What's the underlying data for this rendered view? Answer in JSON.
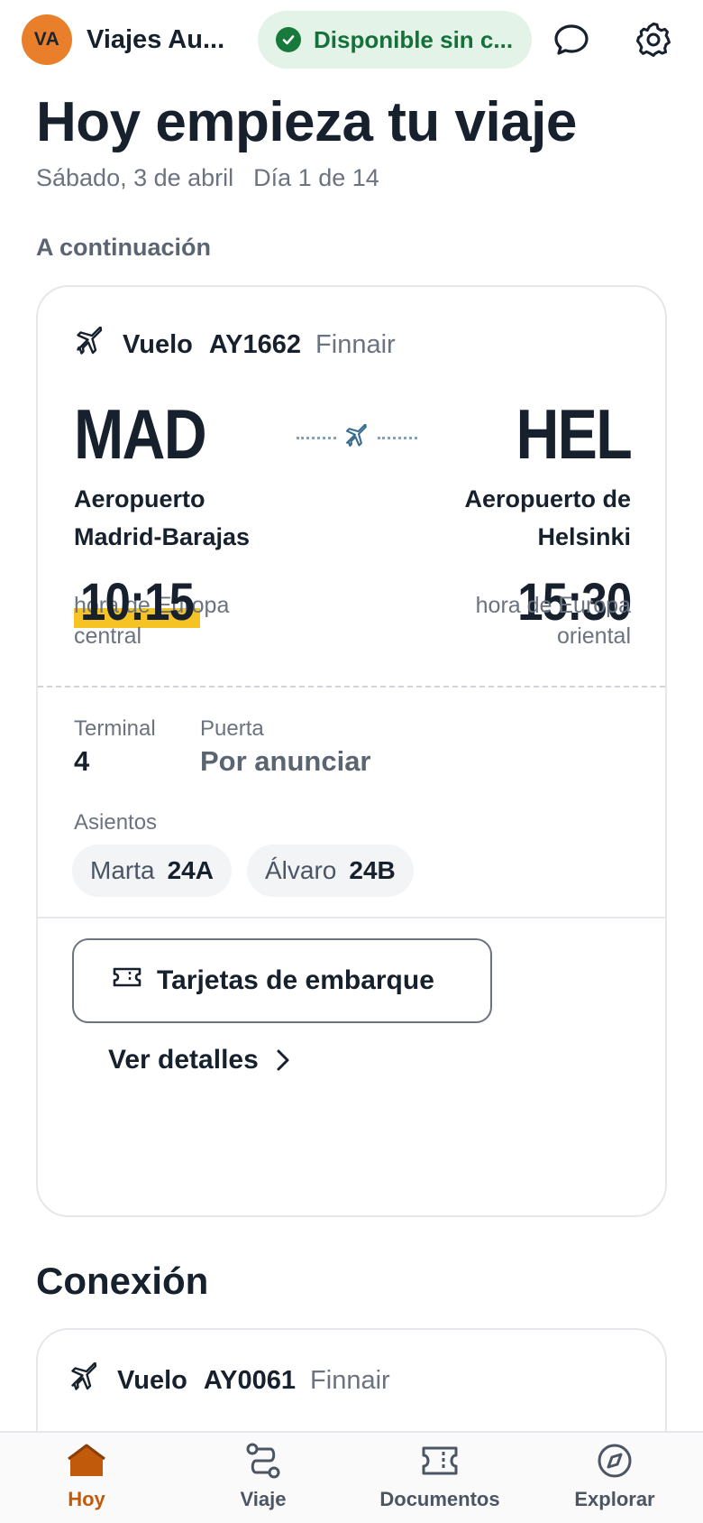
{
  "header": {
    "avatar_initials": "VA",
    "agency_name": "Viajes Au...",
    "status_text": "Disponible sin c...",
    "status_color": "#15703a",
    "chat_icon": "chat-bubble-icon",
    "settings_icon": "gear-icon"
  },
  "page": {
    "title": "Hoy empieza tu viaje",
    "date": "Sábado, 3 de abril",
    "day_of_trip": "Día 1 de 14",
    "next_label": "A continuación"
  },
  "flight": {
    "label": "Vuelo",
    "number": "AY1662",
    "airline": "Finnair",
    "from_code": "MAD",
    "to_code": "HEL",
    "from_airport_line1": "Aeropuerto",
    "from_airport_line2": "Madrid-Barajas",
    "to_airport_line1": "Aeropuerto de",
    "to_airport_line2": "Helsinki",
    "departure_time": "10:15",
    "arrival_time": "15:30",
    "from_tz_line1": "hora de Europa",
    "from_tz_line2": "central",
    "to_tz_line1": "hora de Europa",
    "to_tz_line2": "oriental",
    "terminal_label": "Terminal",
    "terminal_value": "4",
    "gate_label": "Puerta",
    "gate_value": "Por anunciar",
    "seats_label": "Asientos",
    "seats": [
      {
        "name": "Marta",
        "seat": "24A"
      },
      {
        "name": "Álvaro",
        "seat": "24B"
      }
    ],
    "boarding_pass_button": "Tarjetas de embarque",
    "details_link": "Ver detalles"
  },
  "connection": {
    "title": "Conexión",
    "flight_label": "Vuelo",
    "flight_number": "AY0061",
    "airline": "Finnair"
  },
  "nav": {
    "items": [
      {
        "label": "Hoy",
        "icon": "home-icon",
        "active": true
      },
      {
        "label": "Viaje",
        "icon": "route-icon",
        "active": false
      },
      {
        "label": "Documentos",
        "icon": "ticket-icon",
        "active": false
      },
      {
        "label": "Explorar",
        "icon": "compass-icon",
        "active": false
      }
    ],
    "active_color": "#c25a0c"
  }
}
